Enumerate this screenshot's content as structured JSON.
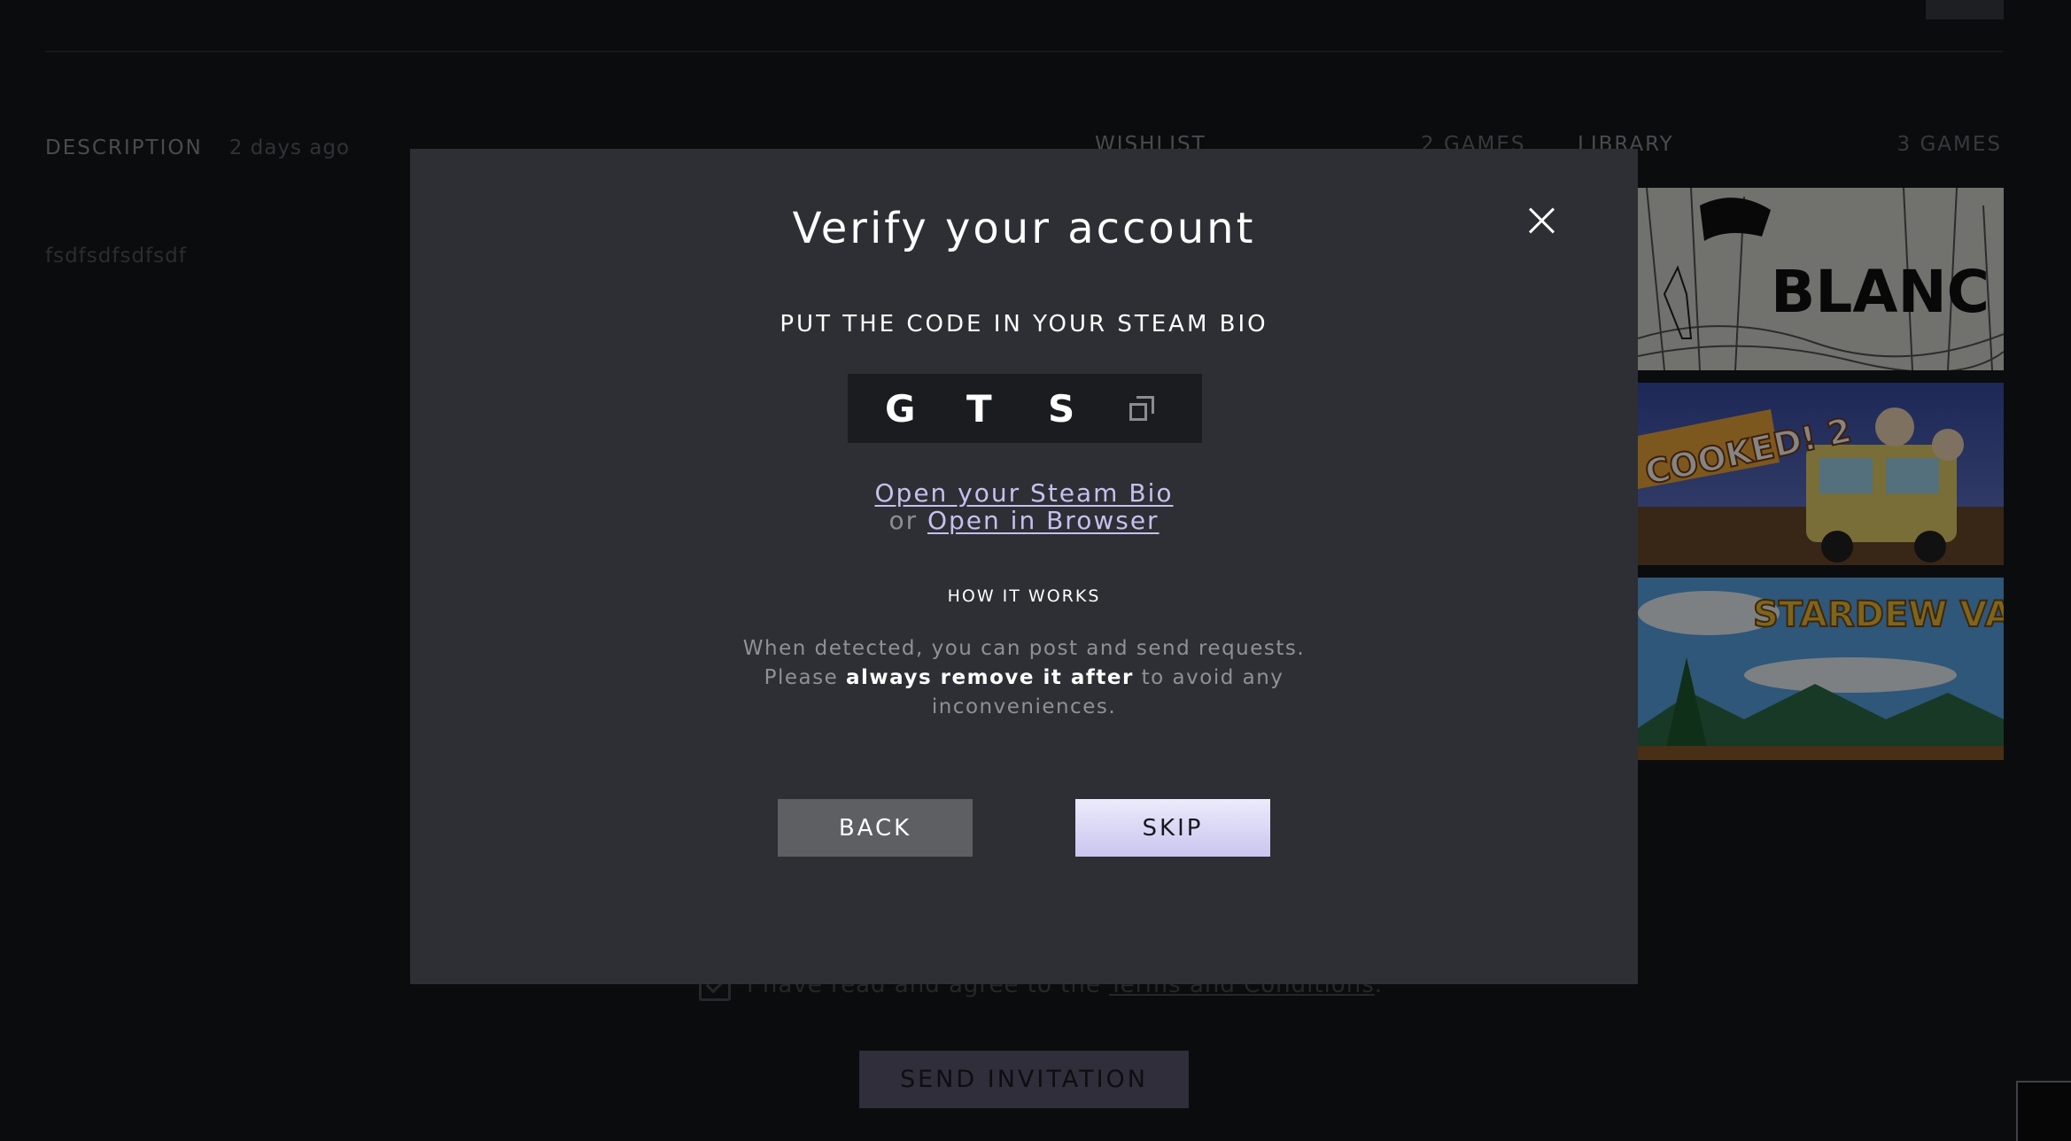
{
  "background": {
    "description": {
      "title": "DESCRIPTION",
      "time": "2 days ago",
      "body": "fsdfsdfsdfsdf"
    },
    "wishlist": {
      "title": "WISHLIST",
      "count": "2 GAMES"
    },
    "library": {
      "title": "LIBRARY",
      "count": "3 GAMES",
      "games": [
        {
          "name": "BLANC",
          "icon": "blanc-cover"
        },
        {
          "name": "COOKED! 2",
          "icon": "overcooked-2-cover"
        },
        {
          "name": "STARDEW VALLEY",
          "icon": "stardew-valley-cover"
        }
      ]
    },
    "terms": {
      "text_before": "I have read and agree to the ",
      "link": "Terms and Conditions",
      "text_after": "."
    },
    "send_button": "SEND INVITATION"
  },
  "modal": {
    "title": "Verify your account",
    "subtitle": "PUT THE CODE IN YOUR STEAM BIO",
    "code": [
      "G",
      "T",
      "S"
    ],
    "open_bio_link": "Open your Steam Bio",
    "or_text": "or ",
    "open_browser_link": "Open in Browser",
    "how_title": "HOW IT WORKS",
    "how_line1": "When detected, you can post and send requests.",
    "how_please": "Please ",
    "how_bold": "always remove it after",
    "how_rest": " to avoid any inconveniences.",
    "back_button": "BACK",
    "skip_button": "SKIP"
  },
  "colors": {
    "modal_bg": "#2d2f34",
    "accent_link": "#c5c0ee",
    "skip_bg": "#d6d2f5",
    "back_bg": "#5e5f63"
  }
}
